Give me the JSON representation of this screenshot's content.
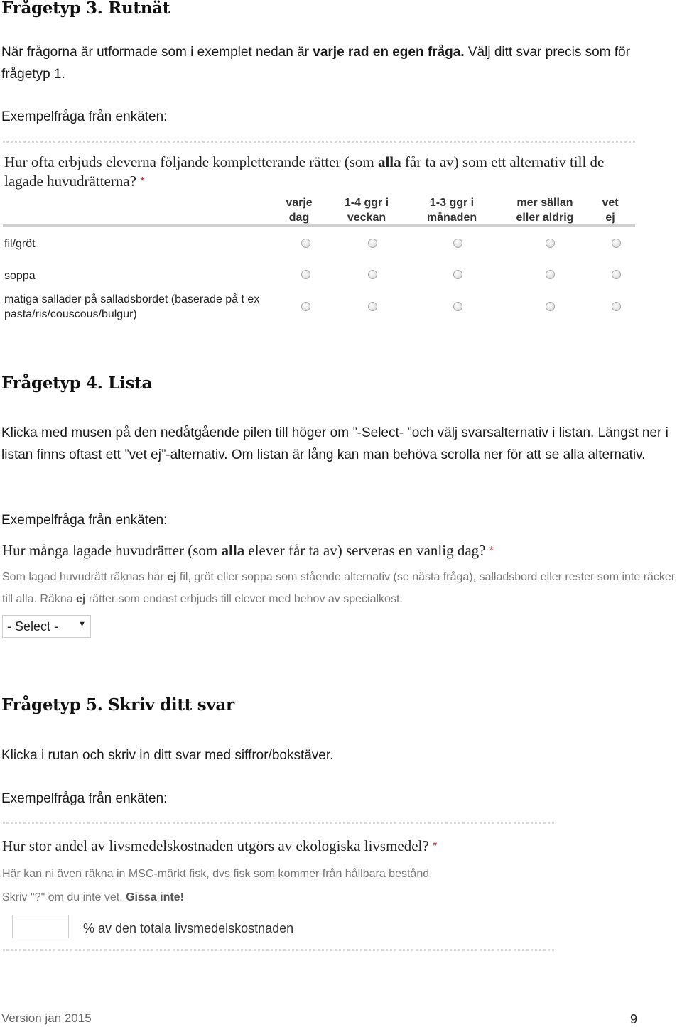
{
  "section3": {
    "heading": "Frågetyp 3. Rutnät",
    "intro_pre": "När frågorna är utformade som i exemplet nedan är ",
    "intro_bold": "varje rad en egen fråga.",
    "intro_post": " Välj ditt svar precis som för frågetyp 1.",
    "example_label": "Exempelfråga från enkäten:",
    "question_pre": "Hur ofta erbjuds eleverna följande kompletterande rätter (som ",
    "question_bold": "alla",
    "question_post": " får ta av) som ett alternativ till de lagade huvudrätterna?",
    "required_mark": "*",
    "columns": [
      {
        "line1": "varje",
        "line2": "dag"
      },
      {
        "line1": "1-4 ggr i",
        "line2": "veckan"
      },
      {
        "line1": "1-3 ggr i",
        "line2": "månaden"
      },
      {
        "line1": "mer sällan",
        "line2": "eller aldrig"
      },
      {
        "line1": "vet",
        "line2": "ej"
      }
    ],
    "rows": [
      {
        "label": "fil/gröt"
      },
      {
        "label": "soppa"
      },
      {
        "label": "matiga sallader på salladsbordet (baserade på t ex pasta/ris/couscous/bulgur)"
      }
    ]
  },
  "section4": {
    "heading": "Frågetyp 4. Lista",
    "intro": "Klicka med musen på den nedåtgående pilen till höger om ”-Select- ”och välj svarsalternativ i listan. Längst ner i listan finns oftast ett ”vet ej”-alternativ. Om listan är lång kan man behöva scrolla ner för att se alla alternativ.",
    "example_label": "Exempelfråga från enkäten:",
    "question_pre": "Hur många lagade huvudrätter (som ",
    "question_bold": "alla",
    "question_post": " elever får ta av) serveras en vanlig dag?",
    "required_mark": "*",
    "help_pre": "Som lagad huvudrätt räknas här ",
    "help_bold1": "ej",
    "help_mid": " fil, gröt eller soppa som stående alternativ (se nästa fråga), salladsbord eller rester som inte räcker till alla. Räkna ",
    "help_bold2": "ej",
    "help_post": " rätter som endast erbjuds till elever med behov av specialkost.",
    "select_value": "- Select -",
    "select_arrow": "▼"
  },
  "section5": {
    "heading": "Frågetyp 5. Skriv ditt svar",
    "intro": "Klicka i rutan och skriv in ditt svar med siffror/bokstäver.",
    "example_label": "Exempelfråga från enkäten:",
    "question": "Hur stor andel av livsmedelskostnaden utgörs av ekologiska livsmedel?",
    "required_mark": "*",
    "help1": "Här kan ni även räkna in MSC-märkt fisk, dvs fisk som kommer från hållbara bestånd.",
    "help2_pre": "Skriv \"?\" om du inte vet. ",
    "help2_bold": "Gissa inte!",
    "input_value": "",
    "input_suffix": "% av den totala livsmedelskostnaden"
  },
  "footer": {
    "version": "Version jan 2015",
    "page_number": "9"
  }
}
